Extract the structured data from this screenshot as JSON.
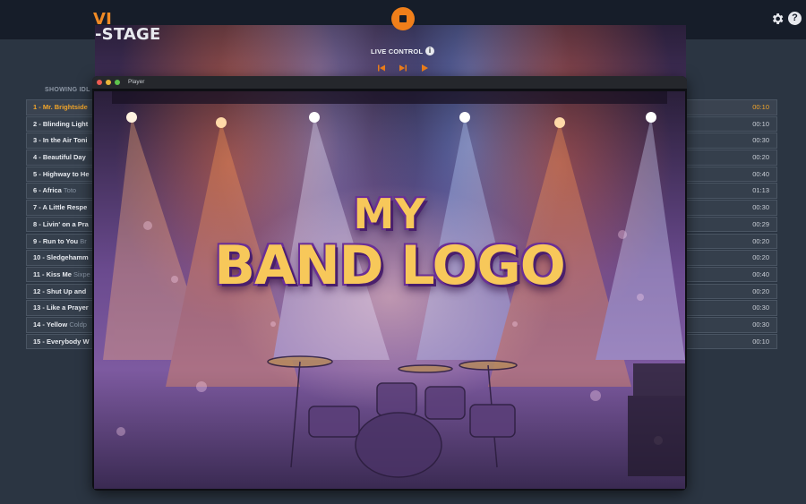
{
  "app": {
    "logo_prefix": "VI",
    "logo_suffix": "-STAGE"
  },
  "header": {
    "stop_icon": "stop-icon",
    "settings_icon": "gear-icon",
    "help_icon": "help-icon",
    "help_glyph": "?"
  },
  "live_control": {
    "label": "LIVE CONTROL",
    "info_glyph": "i",
    "buttons": [
      "skip-to-start-icon",
      "next-track-icon",
      "play-icon"
    ]
  },
  "playlist": {
    "heading": "SHOWING IDL",
    "items": [
      {
        "title": "1 - Mr. Brightside",
        "artist": "",
        "duration": "00:10",
        "active": true
      },
      {
        "title": "2 - Blinding Light",
        "artist": "",
        "duration": "00:10"
      },
      {
        "title": "3 - In the Air Toni",
        "artist": "",
        "duration": "00:30"
      },
      {
        "title": "4 - Beautiful Day",
        "artist": "",
        "duration": "00:20"
      },
      {
        "title": "5 - Highway to He",
        "artist": "",
        "duration": "00:40"
      },
      {
        "title": "6 - Africa",
        "artist": "Toto",
        "duration": "01:13"
      },
      {
        "title": "7 - A Little Respe",
        "artist": "",
        "duration": "00:30"
      },
      {
        "title": "8 - Livin' on a Pra",
        "artist": "",
        "duration": "00:29"
      },
      {
        "title": "9 - Run to You",
        "artist": "Br",
        "duration": "00:20"
      },
      {
        "title": "10 - Sledgehamm",
        "artist": "",
        "duration": "00:20"
      },
      {
        "title": "11 - Kiss Me",
        "artist": "Sixpe",
        "duration": "00:40"
      },
      {
        "title": "12 - Shut Up and",
        "artist": "",
        "duration": "00:20"
      },
      {
        "title": "13 - Like a Prayer",
        "artist": "",
        "duration": "00:30"
      },
      {
        "title": "14 - Yellow",
        "artist": "Coldp",
        "duration": "00:30"
      },
      {
        "title": "15 - Everybody W",
        "artist": "",
        "duration": "00:10"
      }
    ]
  },
  "player": {
    "window_title": "Player",
    "logo_line1": "MY",
    "logo_line2": "BAND LOGO"
  },
  "colors": {
    "accent": "#f07f1a",
    "active_track": "#f2a52a",
    "topbar": "#161d29",
    "background": "#2b3542"
  }
}
